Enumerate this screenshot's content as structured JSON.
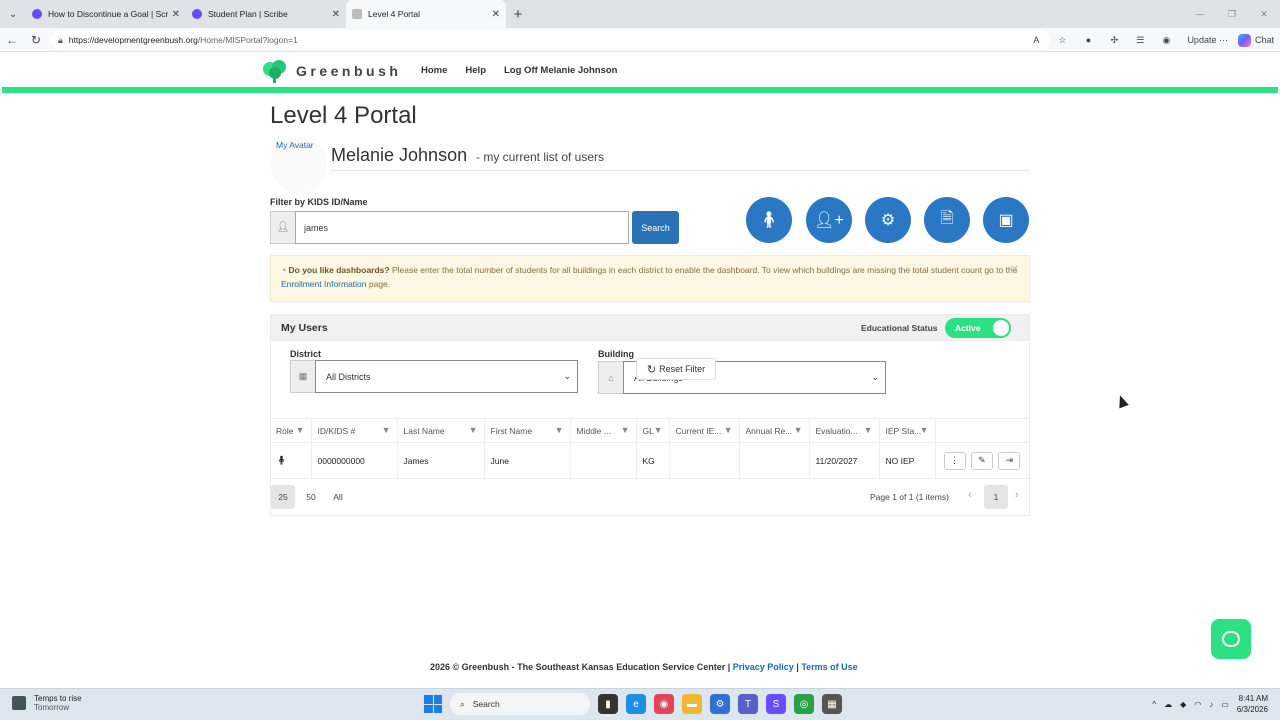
{
  "browser": {
    "tabs": [
      {
        "title": "How to Discontinue a Goal | Scribe",
        "color": "#6a4cff"
      },
      {
        "title": "Student Plan | Scribe",
        "color": "#6a4cff"
      },
      {
        "title": "Level 4 Portal",
        "color": "#999999"
      }
    ],
    "url_host": "https://developmentgreenbush.org",
    "url_path": "/Home/MISPortal?logon=1",
    "update_label": "Update",
    "chat_label": "Chat"
  },
  "nav": {
    "brand": "Greenbush",
    "links": [
      "Home",
      "Help",
      "Log Off Melanie Johnson"
    ]
  },
  "page": {
    "title": "Level 4 Portal",
    "avatar_alt": "My Avatar",
    "user_name": "Melanie Johnson",
    "user_sub": "- my current list of users",
    "filter_label": "Filter by KIDS ID/Name",
    "search_value": "james",
    "search_button": "Search"
  },
  "alert": {
    "bold": "Do you like dashboards?",
    "text": " Please enter the total number of students for all buildings in each district to enable the dashboard. To view which buildings are missing the total student count go to the ",
    "link": "Enrollment Information",
    "tail": " page."
  },
  "users": {
    "title": "My Users",
    "edu_status_label": "Educational Status",
    "toggle_label": "Active",
    "district_label": "District",
    "district_value": "All Districts",
    "building_label": "Building",
    "building_value": "All Buildings",
    "reset_label": "Reset Filter",
    "columns": [
      "Role",
      "ID/KIDS #",
      "Last Name",
      "First Name",
      "Middle ...",
      "GL",
      "Current IE...",
      "Annual Re...",
      "Evaluatio...",
      "IEP Sta..."
    ],
    "rows": [
      {
        "id": "0000000000",
        "last": "James",
        "first": "June",
        "middle": "",
        "gl": "KG",
        "current": "",
        "annual": "",
        "eval": "11/20/2027",
        "status": "NO IEP"
      }
    ],
    "page_sizes": [
      "25",
      "50",
      "All"
    ],
    "page_info": "Page 1 of 1 (1 items)",
    "current_page": "1"
  },
  "footer": {
    "text": "2026 © Greenbush - The Southeast Kansas Education Service Center | ",
    "privacy": "Privacy Policy",
    "sep": " | ",
    "terms": "Terms of Use"
  },
  "taskbar": {
    "weather_title": "Temps to rise",
    "weather_sub": "Tomorrow",
    "search_label": "Search",
    "time": "8:41 AM",
    "date": "6/3/2026"
  },
  "colors": {
    "accent_green": "#2ee084",
    "primary_blue": "#2a78c4"
  }
}
